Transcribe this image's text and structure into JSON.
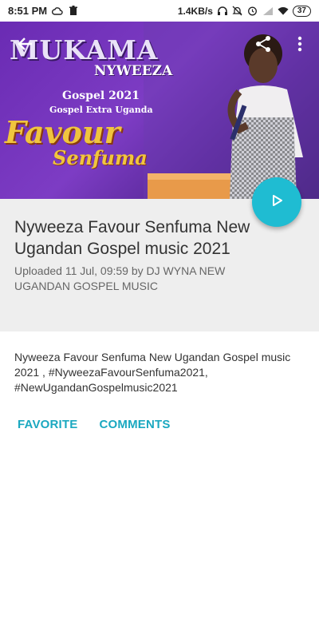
{
  "status_bar": {
    "time": "8:51 PM",
    "net_speed": "1.4KB/s",
    "battery": "37"
  },
  "hero": {
    "title_main": "MUKAMA",
    "title_sub": "NYWEEZA",
    "gospel_line": "Gospel 2021",
    "extra_line": "Gospel Extra Uganda",
    "name_first": "Favour",
    "name_last": "Senfuma"
  },
  "video": {
    "title": "Nyweeza Favour Senfuma New Ugandan Gospel music 2021",
    "uploaded": "Uploaded 11 Jul, 09:59 by DJ WYNA NEW UGANDAN GOSPEL MUSIC",
    "description": "Nyweeza Favour Senfuma New Ugandan Gospel music 2021 , #NyweezaFavourSenfuma2021, #NewUgandanGospelmusic2021"
  },
  "actions": {
    "favorite": "FAVORITE",
    "comments": "COMMENTS"
  },
  "colors": {
    "accent": "#1fbcd2",
    "link": "#1aa8c0",
    "panel": "#eeeeee"
  },
  "icons": [
    "cloud-icon",
    "trash-icon",
    "headphones-icon",
    "mute-icon",
    "alarm-icon",
    "signal-icon",
    "wifi-icon",
    "back-arrow-icon",
    "share-icon",
    "more-vert-icon",
    "play-icon"
  ]
}
